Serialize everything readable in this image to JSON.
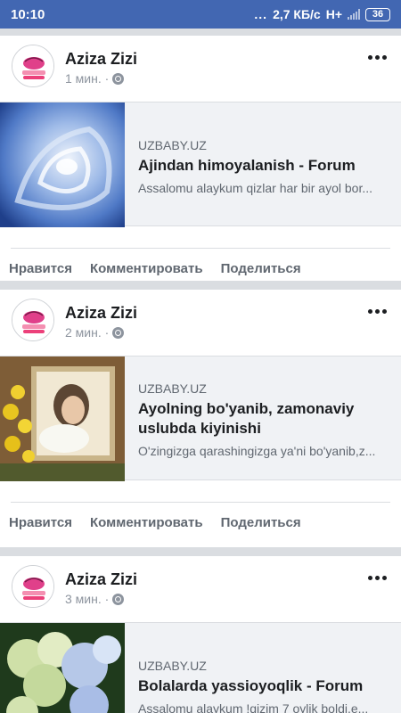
{
  "status_bar": {
    "time": "10:10",
    "dots": "...",
    "network_speed": "2,7 КБ/с",
    "network_type": "H+",
    "battery": "36"
  },
  "colors": {
    "header_blue": "#4267b2",
    "feed_background": "#dadde1",
    "card_background": "#f0f2f5"
  },
  "posts": [
    {
      "author": "Aziza Zizi",
      "time": "1 мин. ·",
      "link": {
        "domain": "UZBABY.UZ",
        "title": "Ajindan himoyalanish - Forum",
        "description": "Assalomu alaykum qizlar har bir ayol bor..."
      },
      "actions": {
        "like": "Нравится",
        "comment": "Комментировать",
        "share": "Поделиться"
      }
    },
    {
      "author": "Aziza Zizi",
      "time": "2 мин. ·",
      "link": {
        "domain": "UZBABY.UZ",
        "title": "Ayolning bo'yanib, zamonaviy uslubda kiyinishi",
        "description": "O'zingizga qarashingizga ya'ni bo'yanib,z..."
      },
      "actions": {
        "like": "Нравится",
        "comment": "Комментировать",
        "share": "Поделиться"
      }
    },
    {
      "author": "Aziza Zizi",
      "time": "3 мин. ·",
      "link": {
        "domain": "UZBABY.UZ",
        "title": "Bolalarda yassioyoqlik - Forum",
        "description": "Assalomu alaykum !qizim 7 oylik boldi.e..."
      }
    }
  ]
}
